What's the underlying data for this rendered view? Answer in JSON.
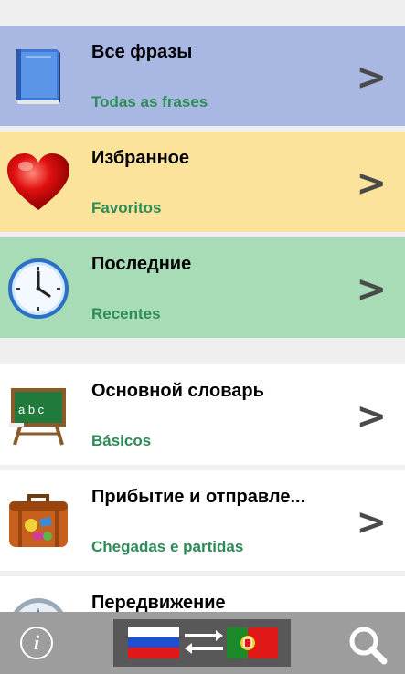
{
  "items": [
    {
      "title": "Все фразы",
      "subtitle": "Todas as frases",
      "icon": "book-icon",
      "bg": "#a8b8e2"
    },
    {
      "title": "Избранное",
      "subtitle": "Favoritos",
      "icon": "heart-icon",
      "bg": "#fbe39b"
    },
    {
      "title": "Последние",
      "subtitle": "Recentes",
      "icon": "clock-icon",
      "bg": "#a8dcb6"
    },
    {
      "title": "Основной словарь",
      "subtitle": "Básicos",
      "icon": "chalkboard-icon",
      "bg": "#ffffff"
    },
    {
      "title": "Прибытие и отправле...",
      "subtitle": "Chegadas e partidas",
      "icon": "suitcase-icon",
      "bg": "#ffffff"
    },
    {
      "title": "Передвижение",
      "subtitle": "",
      "icon": "compass-icon",
      "bg": "#ffffff"
    }
  ],
  "chevron": ">",
  "bottombar": {
    "info_label": "i",
    "from_flag": "russia-flag-icon",
    "to_flag": "portugal-flag-icon",
    "search_icon": "search-icon"
  }
}
